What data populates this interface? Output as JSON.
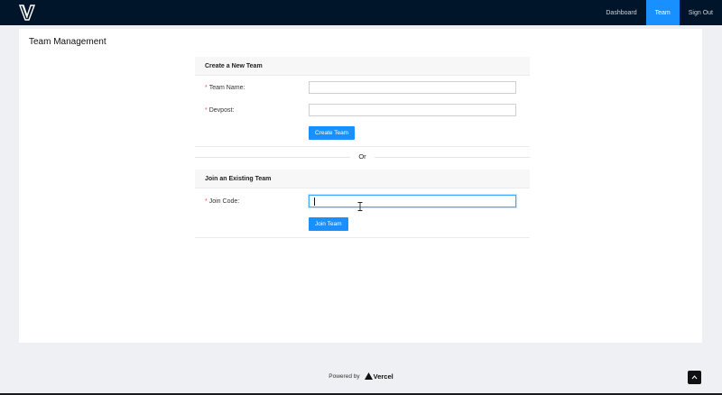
{
  "nav": {
    "items": [
      {
        "label": "Dashboard",
        "active": false
      },
      {
        "label": "Team",
        "active": true
      },
      {
        "label": "Sign Out",
        "active": false
      }
    ]
  },
  "page": {
    "title": "Team Management"
  },
  "create_team": {
    "header": "Create a New Team",
    "team_name_label": "Team Name",
    "devpost_label": "Devpost",
    "team_name_value": "",
    "devpost_value": "",
    "button": "Create Team"
  },
  "divider": {
    "text": "Or"
  },
  "join_team": {
    "header": "Join an Existing Team",
    "join_code_label": "Join Code",
    "join_code_value": "",
    "button": "Join Team"
  },
  "footer": {
    "powered_by": "Powered by",
    "brand": "Vercel"
  },
  "colors": {
    "topbar": "#001529",
    "accent": "#1890ff",
    "required": "#ff4d4f"
  }
}
